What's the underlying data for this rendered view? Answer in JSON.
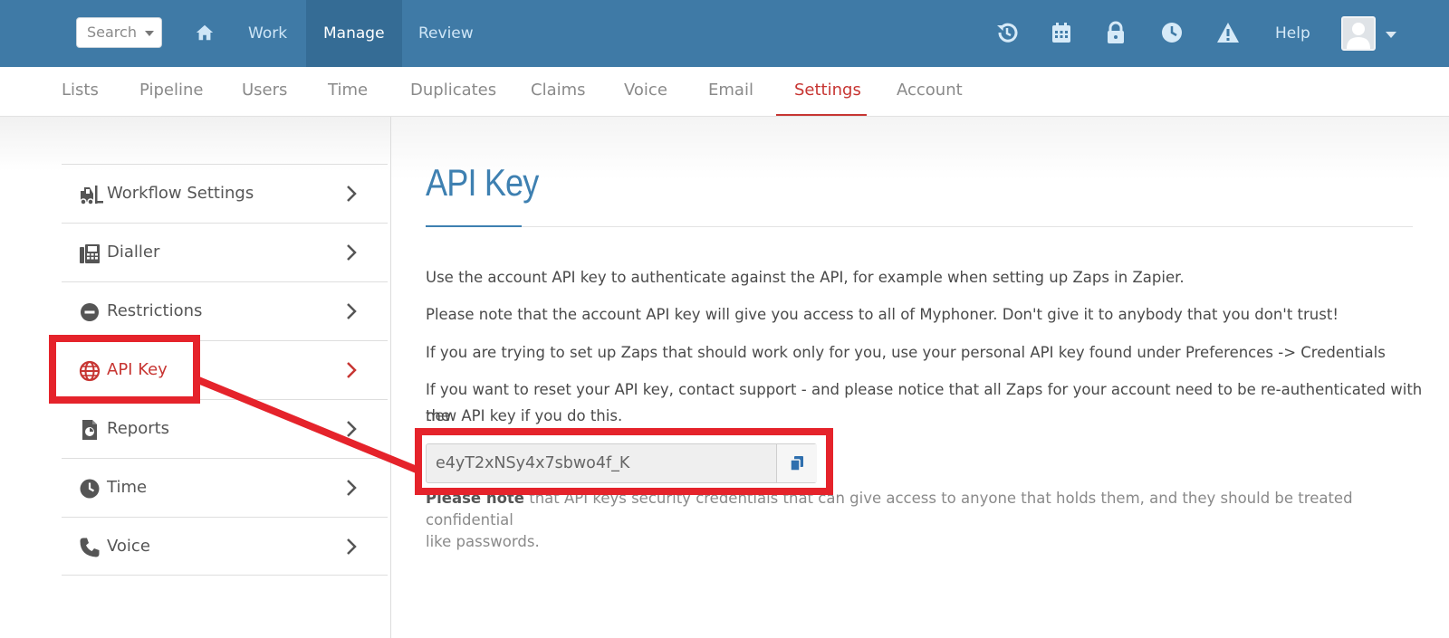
{
  "topbar": {
    "search_placeholder": "Search",
    "nav": [
      {
        "label": "Work"
      },
      {
        "label": "Manage"
      },
      {
        "label": "Review"
      }
    ],
    "help_label": "Help"
  },
  "subnav": {
    "tabs": [
      "Lists",
      "Pipeline",
      "Users",
      "Time",
      "Duplicates",
      "Claims",
      "Voice",
      "Email",
      "Settings",
      "Account"
    ]
  },
  "sidebar": {
    "items": [
      {
        "label": "Workflow Settings",
        "icon": "forklift-icon"
      },
      {
        "label": "Dialler",
        "icon": "fax-icon"
      },
      {
        "label": "Restrictions",
        "icon": "minus-circle-icon"
      },
      {
        "label": "API Key",
        "icon": "globe-icon"
      },
      {
        "label": "Reports",
        "icon": "report-icon"
      },
      {
        "label": "Time",
        "icon": "clock-icon"
      },
      {
        "label": "Voice",
        "icon": "phone-icon"
      }
    ]
  },
  "main": {
    "title": "API Key",
    "paragraphs": [
      "Use the account API key to authenticate against the API, for example when setting up Zaps in Zapier.",
      "Please note that the account API key will give you access to all of Myphoner. Don't give it to anybody that you don't trust!",
      "If you are trying to set up Zaps that should work only for you, use your personal API key found under Preferences -> Credentials",
      "If you want to reset your API key, contact support - and please notice that all Zaps for your account need to be re-authenticated with the",
      "new API key if you do this."
    ],
    "api_key_value": "e4yT2xNSy4x7sbwo4f_K",
    "note_bold": "Please note",
    "note_text": " that API keys security credentials that can give access to anyone that holds them, and they should be treated confidential",
    "note_text_2": "like passwords."
  },
  "colors": {
    "topbar": "#3f7aa6",
    "accent_red": "#c73532",
    "title_blue": "#3e80b1",
    "highlight": "#e5232b"
  }
}
